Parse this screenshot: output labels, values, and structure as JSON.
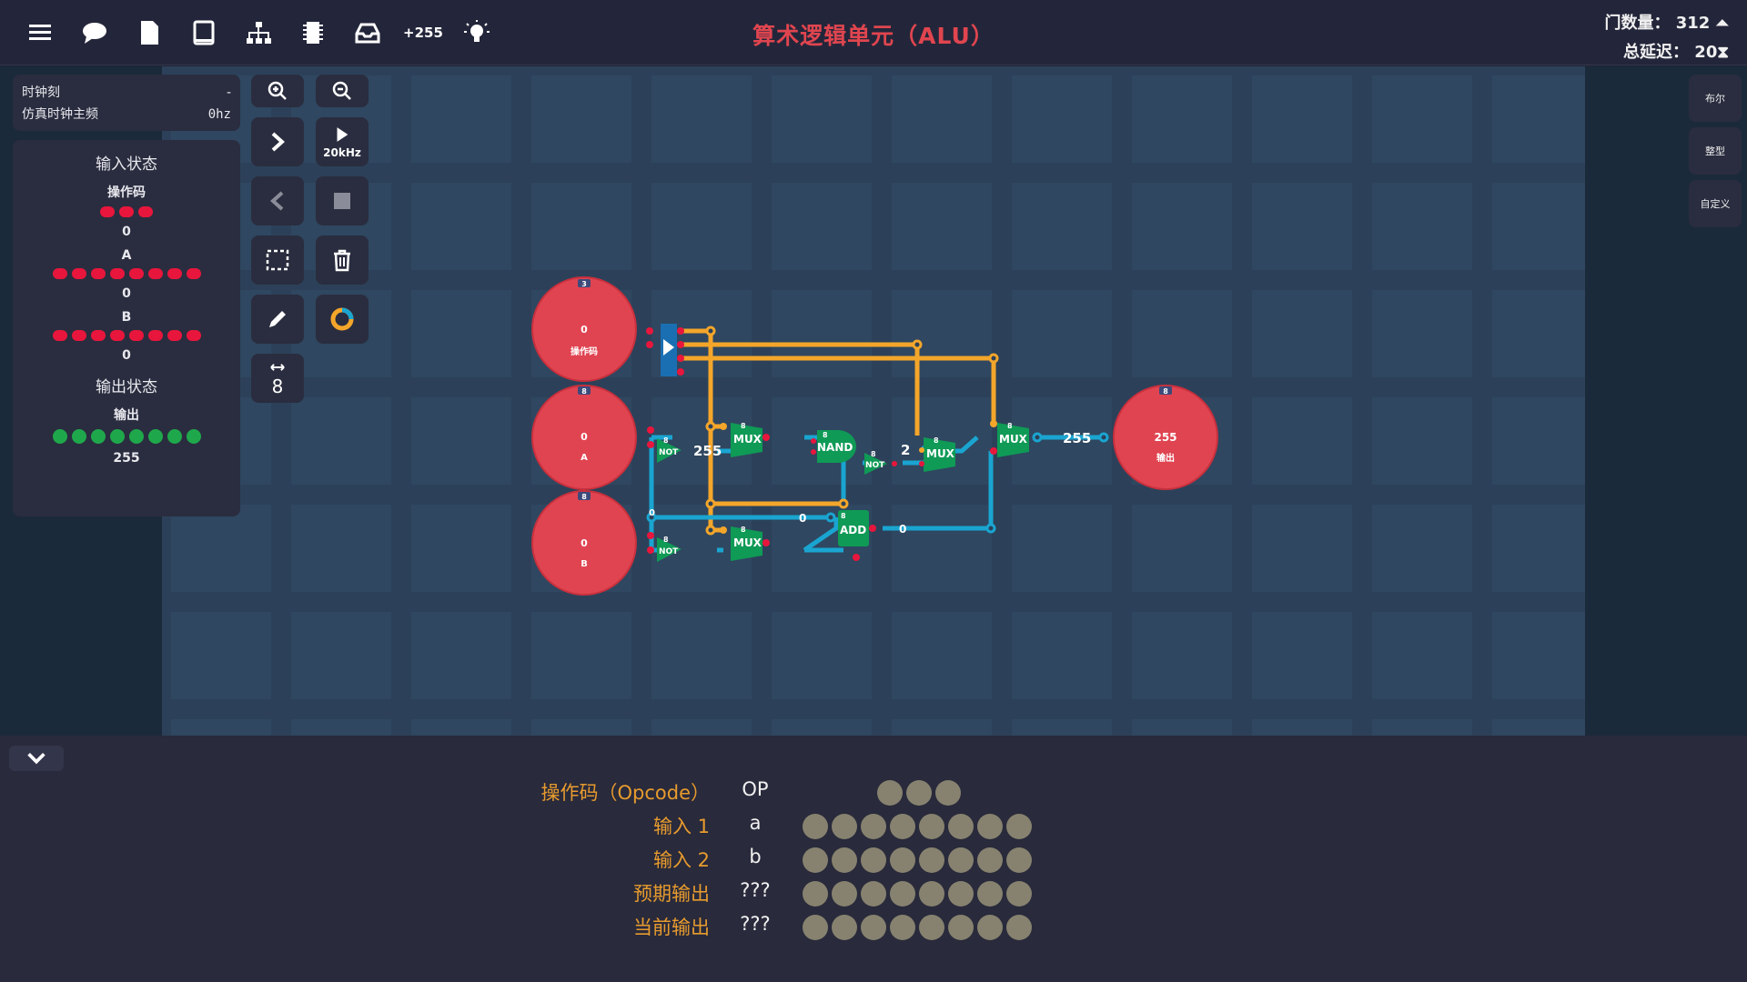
{
  "topbar": {
    "title": "算术逻辑单元（ALU）",
    "badge": "+255",
    "gate_count_label": "门数量： 312",
    "total_delay_label": "总延迟： 20"
  },
  "clock": {
    "tick_label": "时钟刻",
    "tick_value": "-",
    "freq_label": "仿真时钟主频",
    "freq_value": "0hz"
  },
  "io": {
    "input_title": "输入状态",
    "opcode_label": "操作码",
    "opcode_value": "0",
    "a_label": "A",
    "a_value": "0",
    "b_label": "B",
    "b_value": "0",
    "output_title": "输出状态",
    "output_label": "输出",
    "output_value": "255"
  },
  "tools": {
    "speed_label": "20kHz",
    "bitwidth_label": "8"
  },
  "side": {
    "bool": "布尔",
    "int": "整型",
    "custom": "自定义"
  },
  "circuit": {
    "opcode_node": {
      "bits": "3",
      "value": "0",
      "label": "操作码"
    },
    "a_node": {
      "bits": "8",
      "value": "0",
      "label": "A"
    },
    "b_node": {
      "bits": "8",
      "value": "0",
      "label": "B"
    },
    "out_node": {
      "bits": "8",
      "value": "255",
      "label": "输出"
    },
    "gates": {
      "mux": "MUX",
      "nand": "NAND",
      "not": "NOT",
      "add": "ADD",
      "bits": "8"
    },
    "wire_values": {
      "w1": "255",
      "w2": "255",
      "w3": "255",
      "w4": "0",
      "w5": "0",
      "w6": "0",
      "w7": "2"
    }
  },
  "bottom": {
    "rows": [
      {
        "label": "操作码（Opcode）",
        "symbol": "OP",
        "dots": 3
      },
      {
        "label": "输入 1",
        "symbol": "a",
        "dots": 8
      },
      {
        "label": "输入 2",
        "symbol": "b",
        "dots": 8
      },
      {
        "label": "预期输出",
        "symbol": "???",
        "dots": 8
      },
      {
        "label": "当前输出",
        "symbol": "???",
        "dots": 8
      }
    ]
  },
  "colors": {
    "wire_orange": "#f4a62a",
    "wire_blue": "#1aa5d1",
    "gate_green": "#0f9a56",
    "node_red": "#e04451",
    "bit_red": "#e8163c",
    "bit_green": "#1fa84b"
  }
}
